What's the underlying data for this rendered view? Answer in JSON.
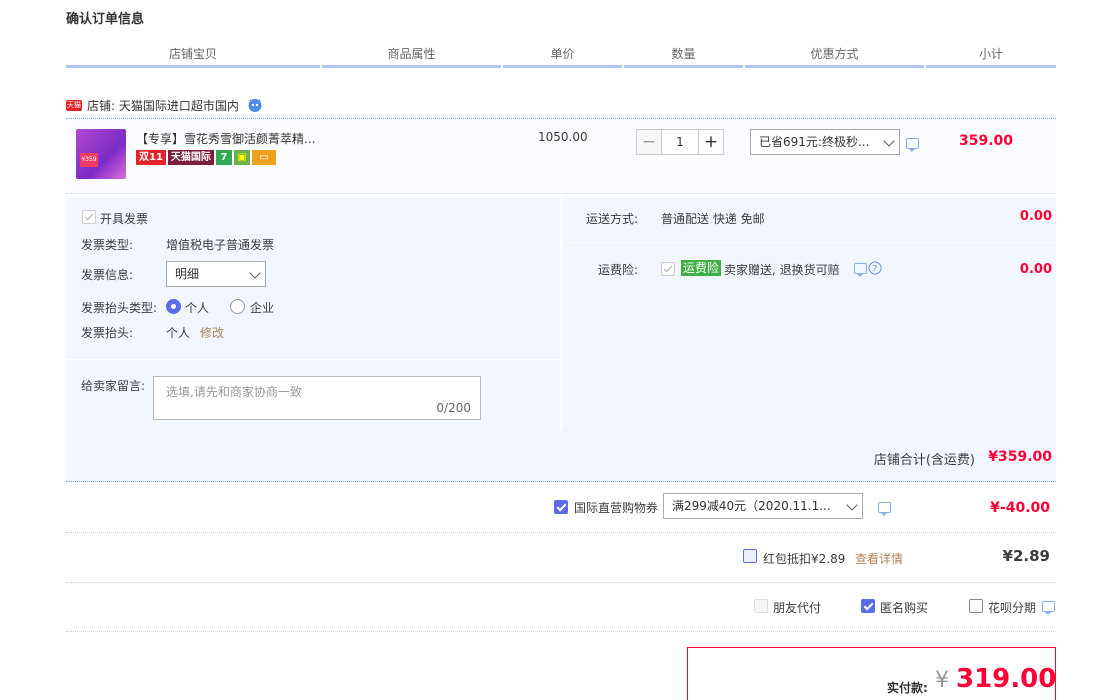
{
  "page_title": "确认订单信息",
  "columns": [
    "店铺宝贝",
    "商品属性",
    "单价",
    "数量",
    "优惠方式",
    "小计"
  ],
  "store": {
    "badge": "天猫",
    "label": "店铺: 天猫国际进口超市国内"
  },
  "item": {
    "name": "【专享】雪花秀雪御活颜菁萃精...",
    "thumb_price": "¥359",
    "tags": [
      "双11",
      "天猫国际",
      "7",
      "▣",
      "▭"
    ],
    "unit_price": "1050.00",
    "quantity": "1",
    "qty_minus": "−",
    "qty_plus": "+",
    "discount": "已省691元:终极秒...",
    "subtotal": "359.00"
  },
  "invoice": {
    "enable_label": "开具发票",
    "type_label": "发票类型:",
    "type_value": "增值税电子普通发票",
    "info_label": "发票信息:",
    "info_value": "明细",
    "header_type_label": "发票抬头类型:",
    "personal": "个人",
    "company": "企业",
    "header_label": "发票抬头:",
    "header_value": "个人",
    "modify": "修改"
  },
  "message": {
    "label": "给卖家留言:",
    "placeholder": "选填,请先和商家协商一致",
    "counter": "0/200"
  },
  "shipping": {
    "label": "运送方式:",
    "value": "普通配送 快递 免邮",
    "price": "0.00"
  },
  "insurance": {
    "label": "运费险:",
    "badge": "运费险",
    "value": "卖家赠送, 退换货可赔",
    "price": "0.00"
  },
  "store_total": {
    "label": "店铺合计(含运费)",
    "value": "¥359.00"
  },
  "coupon": {
    "label": "国际直营购物券",
    "select": "满299减40元（2020.11.1...",
    "value": "¥-40.00"
  },
  "redpacket": {
    "label": "红包抵扣¥2.89",
    "link": "查看详情",
    "value": "¥2.89"
  },
  "options": {
    "friend_pay": "朋友代付",
    "anonymous": "匿名购买",
    "huabei": "花呗分期"
  },
  "payment": {
    "label": "实付款:",
    "currency": "¥",
    "amount": "319.00"
  }
}
